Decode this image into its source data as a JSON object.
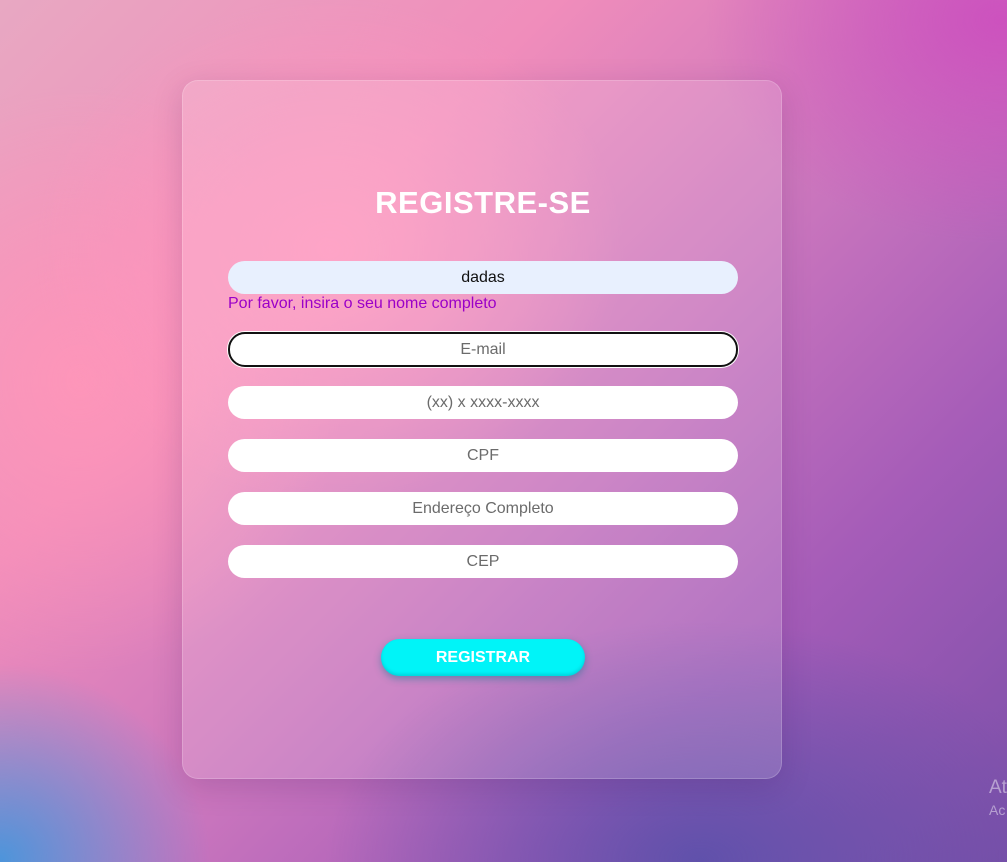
{
  "form": {
    "title": "REGISTRE-SE",
    "name_value": "dadas",
    "name_error": "Por favor, insira o seu nome completo",
    "email_placeholder": "E-mail",
    "phone_placeholder": "(xx) x xxxx-xxxx",
    "cpf_placeholder": "CPF",
    "address_placeholder": "Endereço Completo",
    "cep_placeholder": "CEP",
    "submit_label": "REGISTRAR"
  },
  "watermark": {
    "line1": "At",
    "line2": "Ac"
  },
  "colors": {
    "button": "#00f4f8",
    "error_text": "#9b00c8",
    "title": "#ffffff"
  }
}
